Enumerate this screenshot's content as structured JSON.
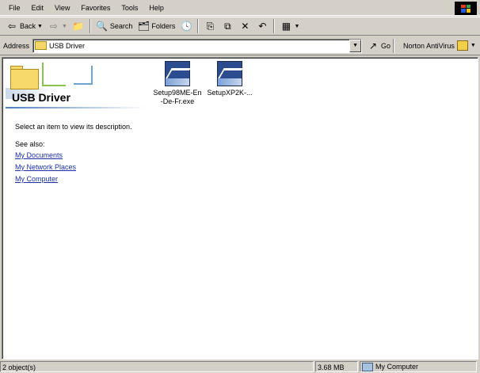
{
  "menu": [
    "File",
    "Edit",
    "View",
    "Favorites",
    "Tools",
    "Help"
  ],
  "toolbar": {
    "back": "Back",
    "search": "Search",
    "folders": "Folders"
  },
  "address": {
    "label": "Address",
    "value": "USB Driver",
    "go": "Go",
    "norton": "Norton AntiVirus"
  },
  "folder_title": "USB Driver",
  "description": "Select an item to view its description.",
  "see_also": "See also:",
  "links": [
    "My Documents",
    "My Network Places",
    "My Computer"
  ],
  "files": [
    {
      "name_line1": "Setup98ME-En",
      "name_line2": "-De-Fr.exe"
    },
    {
      "name_line1": "SetupXP2K-...",
      "name_line2": ""
    }
  ],
  "status": {
    "objects": "2 object(s)",
    "size": "3.68 MB",
    "location": "My Computer"
  }
}
